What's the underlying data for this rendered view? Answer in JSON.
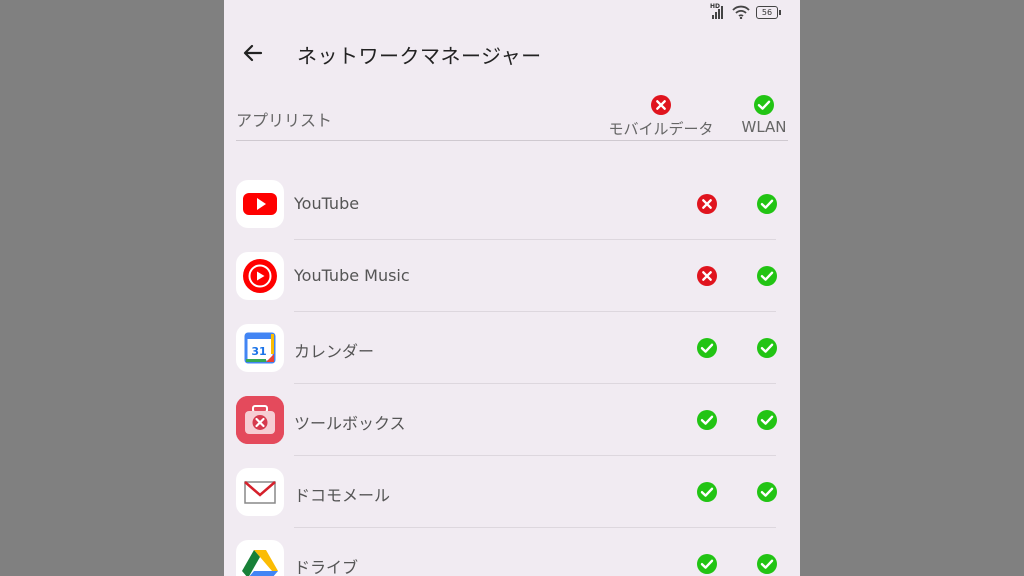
{
  "screen_title": "ネットワークマネージャー",
  "header": {
    "list_label": "アプリリスト",
    "mobile_label": "モバイルデータ",
    "wlan_label": "WLAN",
    "mobile_state": "blocked",
    "wlan_state": "allowed"
  },
  "status_bar": {
    "battery": "56",
    "network": "HD"
  },
  "icons": {
    "back": "arrow-left-icon",
    "allowed": "green-check-icon",
    "blocked": "red-x-icon"
  },
  "colors": {
    "allowed": "#22c414",
    "blocked": "#e0141e",
    "background": "#f1ebf2"
  },
  "apps": [
    {
      "name": "YouTube",
      "mobile": "blocked",
      "wlan": "allowed"
    },
    {
      "name": "YouTube Music",
      "mobile": "blocked",
      "wlan": "allowed"
    },
    {
      "name": "カレンダー",
      "mobile": "allowed",
      "wlan": "allowed"
    },
    {
      "name": "ツールボックス",
      "mobile": "allowed",
      "wlan": "allowed"
    },
    {
      "name": "ドコモメール",
      "mobile": "allowed",
      "wlan": "allowed"
    },
    {
      "name": "ドライブ",
      "mobile": "allowed",
      "wlan": "allowed"
    }
  ]
}
